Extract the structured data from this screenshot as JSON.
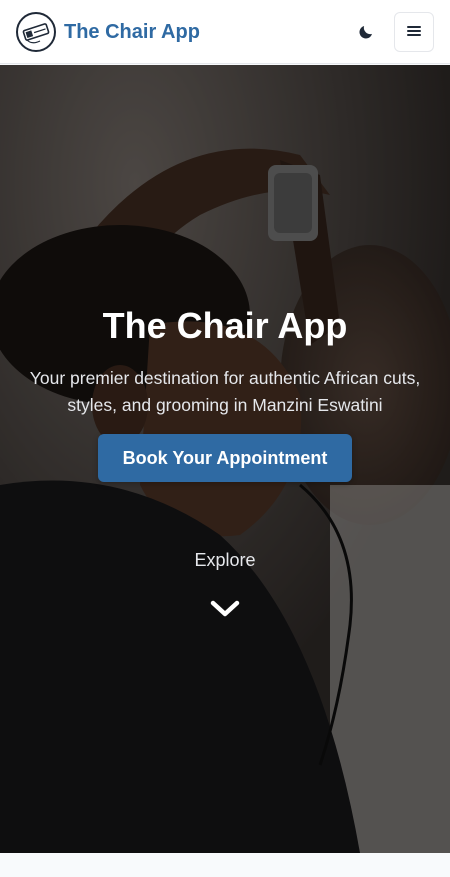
{
  "header": {
    "brand": "The Chair App",
    "logo_icon": "barber-logo-icon",
    "theme_toggle_icon": "moon-icon",
    "menu_icon": "hamburger-menu-icon"
  },
  "hero": {
    "title": "The Chair App",
    "subtitle": "Your premier destination for authentic African cuts, styles, and grooming in Manzini Eswatini",
    "cta_label": "Book Your Appointment",
    "explore_label": "Explore",
    "scroll_icon": "chevron-down-icon"
  },
  "colors": {
    "brand": "#2f6aa3",
    "header_bg": "#ffffff",
    "hero_overlay": "rgba(0,0,0,0.45)",
    "page_bg": "#f8fafc"
  }
}
